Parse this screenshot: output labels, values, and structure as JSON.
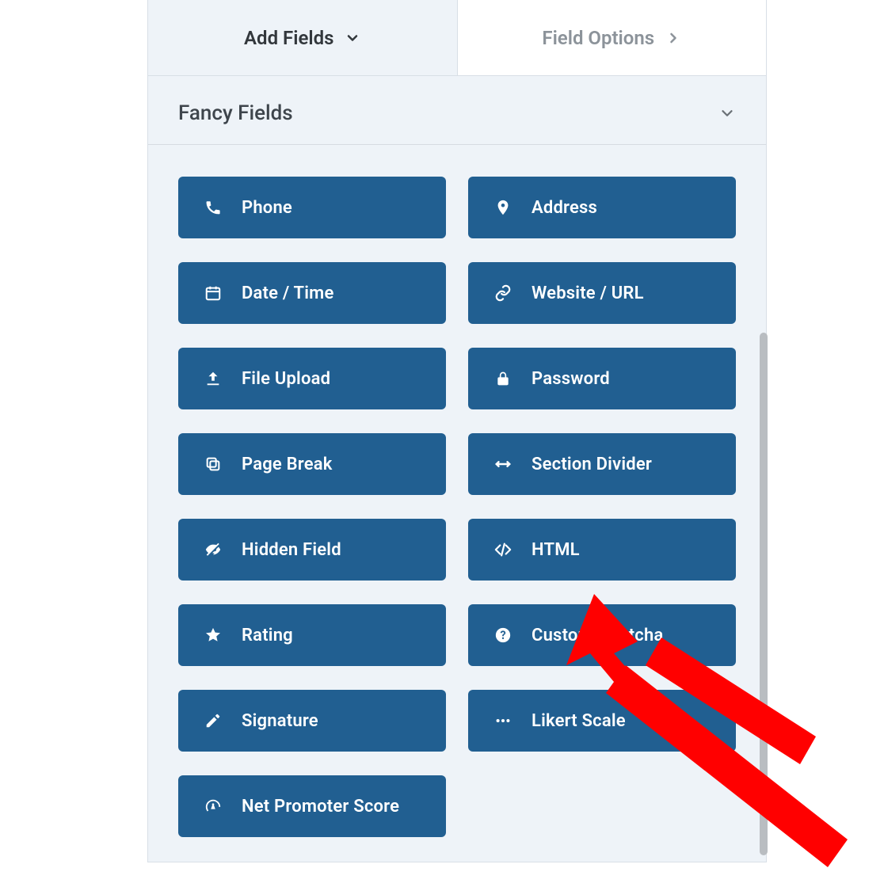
{
  "tabs": {
    "add_fields": "Add Fields",
    "field_options": "Field Options"
  },
  "section": {
    "title": "Fancy Fields"
  },
  "fields": [
    {
      "icon": "phone-icon",
      "label": "Phone"
    },
    {
      "icon": "map-pin-icon",
      "label": "Address"
    },
    {
      "icon": "calendar-icon",
      "label": "Date / Time"
    },
    {
      "icon": "link-icon",
      "label": "Website / URL"
    },
    {
      "icon": "upload-icon",
      "label": "File Upload"
    },
    {
      "icon": "lock-icon",
      "label": "Password"
    },
    {
      "icon": "copy-icon",
      "label": "Page Break"
    },
    {
      "icon": "divider-icon",
      "label": "Section Divider"
    },
    {
      "icon": "eye-slash-icon",
      "label": "Hidden Field"
    },
    {
      "icon": "code-icon",
      "label": "HTML"
    },
    {
      "icon": "star-icon",
      "label": "Rating"
    },
    {
      "icon": "question-circle-icon",
      "label": "Custom Captcha"
    },
    {
      "icon": "pencil-icon",
      "label": "Signature"
    },
    {
      "icon": "ellipsis-icon",
      "label": "Likert Scale"
    },
    {
      "icon": "gauge-icon",
      "label": "Net Promoter Score"
    }
  ],
  "colors": {
    "button_bg": "#215f91",
    "panel_bg": "#eef3f8",
    "annotation": "#ff0000"
  }
}
